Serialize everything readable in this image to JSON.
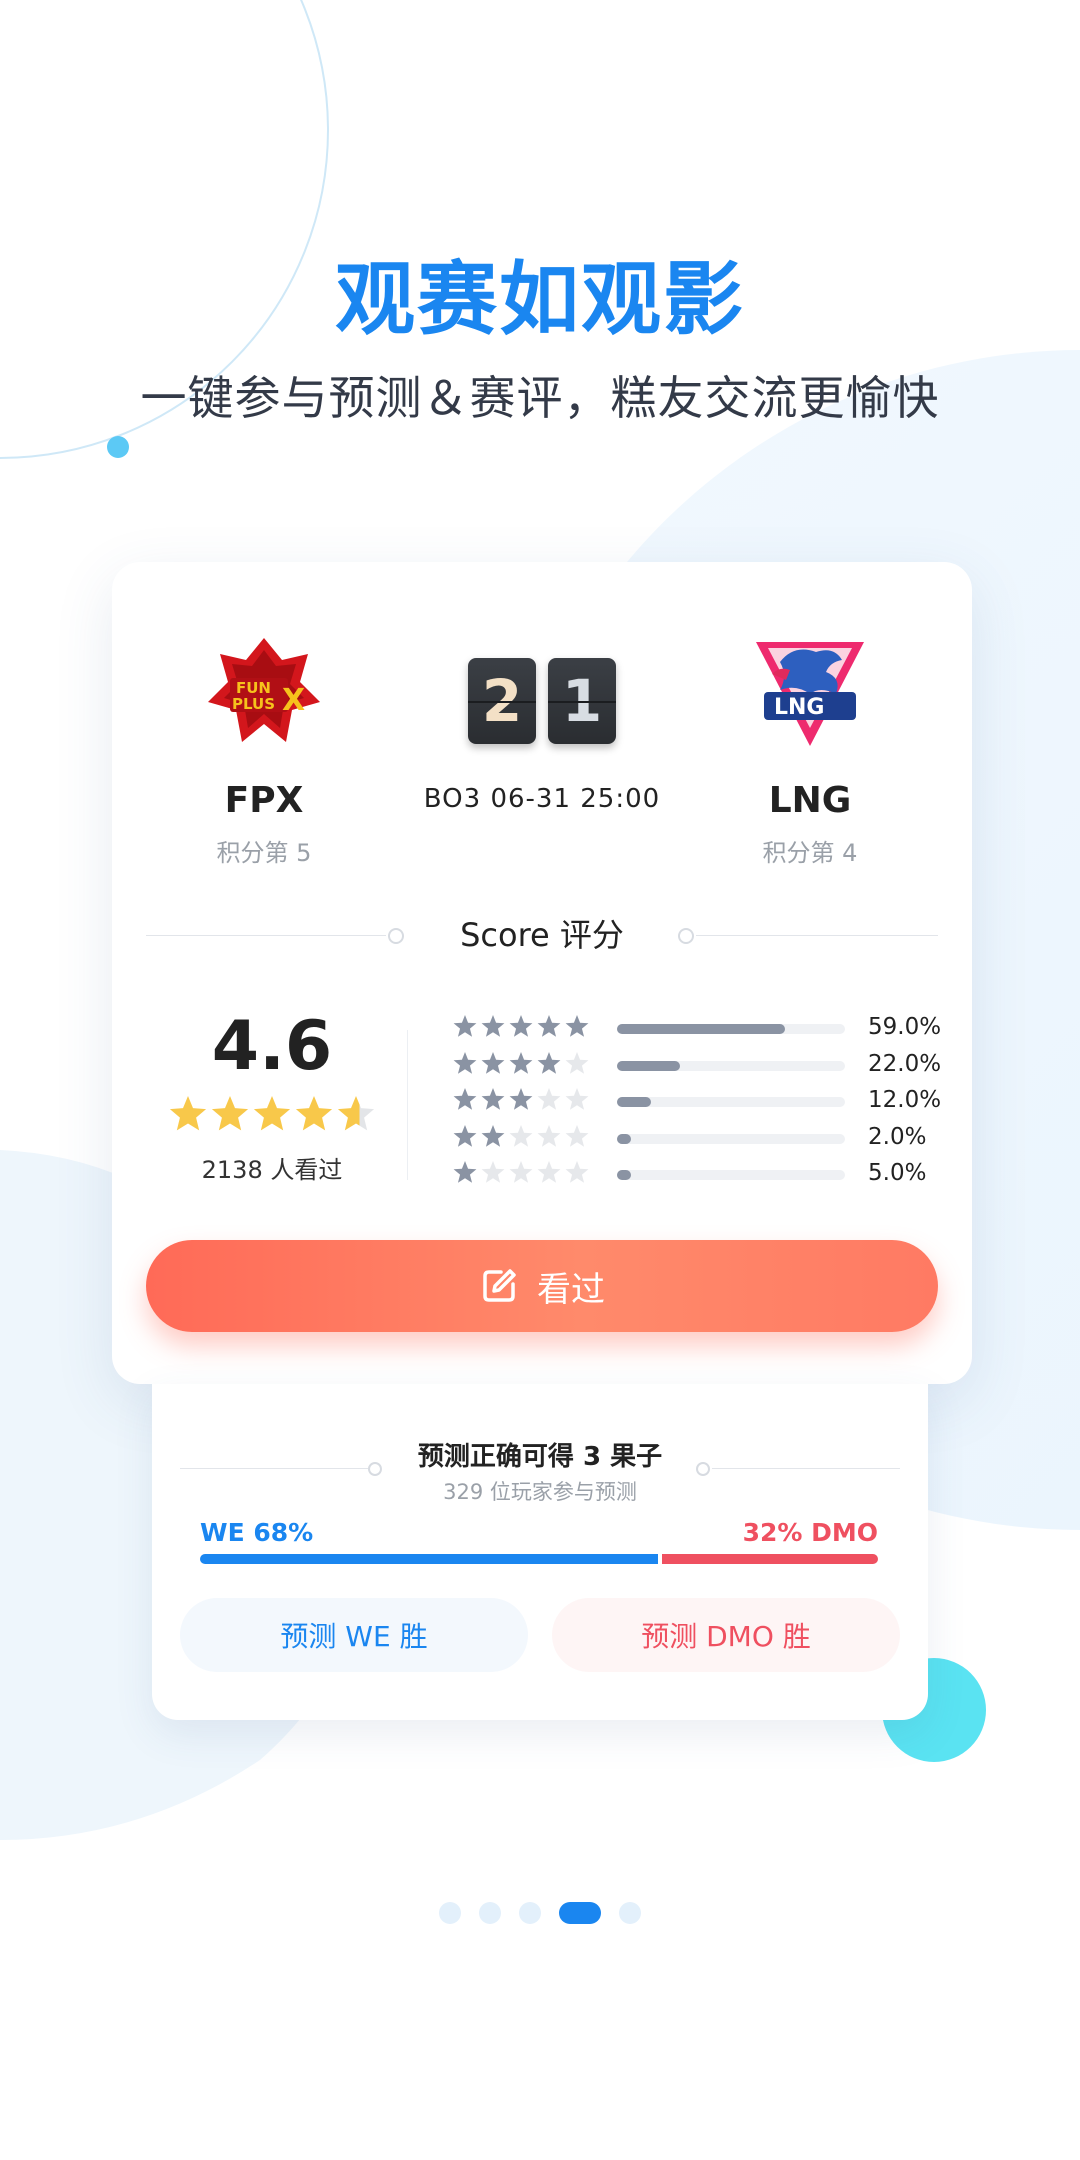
{
  "header": {
    "title": "观赛如观影",
    "subtitle": "一键参与预测＆赛评，糕友交流更愉快"
  },
  "match": {
    "home": {
      "name": "FPX",
      "rank": "积分第 5"
    },
    "away": {
      "name": "LNG",
      "rank": "积分第 4"
    },
    "score_home": "2",
    "score_away": "1",
    "info": "BO3  06-31  25:00"
  },
  "score": {
    "title": "Score 评分",
    "value": "4.6",
    "stars": 4.6,
    "count_label": "2138 人看过",
    "distribution": [
      {
        "stars": 5,
        "percent": 59.0,
        "label": "59.0%"
      },
      {
        "stars": 4,
        "percent": 22.0,
        "label": "22.0%"
      },
      {
        "stars": 3,
        "percent": 12.0,
        "label": "12.0%"
      },
      {
        "stars": 2,
        "percent": 2.0,
        "label": "2.0%"
      },
      {
        "stars": 1,
        "percent": 5.0,
        "label": "5.0%"
      }
    ]
  },
  "watched_button": {
    "label": "看过"
  },
  "prediction": {
    "title": "预测正确可得 3 果子",
    "subtitle": "329 位玩家参与预测",
    "left_label": "WE  68%",
    "right_label": "32% DMO",
    "left_percent": 68,
    "right_percent": 32,
    "left_button": "预测 WE 胜",
    "right_button": "预测 DMO 胜"
  },
  "pager": {
    "count": 5,
    "active_index": 3
  },
  "colors": {
    "accent_blue": "#1a86f0",
    "accent_red": "#ef5060",
    "button_orange": "#ff7a5c",
    "star_gold": "#f8c84a",
    "star_gray": "#8a93a3"
  }
}
